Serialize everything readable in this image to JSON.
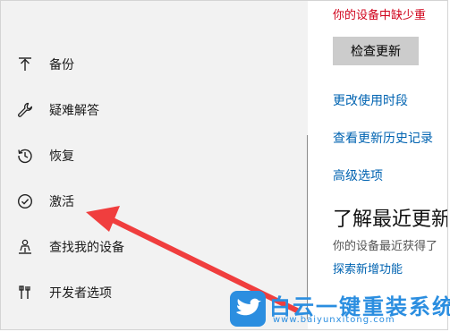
{
  "sidebar": {
    "items": [
      {
        "label": "备份",
        "icon": "backup-arrow-icon"
      },
      {
        "label": "疑难解答",
        "icon": "wrench-icon"
      },
      {
        "label": "恢复",
        "icon": "history-icon"
      },
      {
        "label": "激活",
        "icon": "checkmark-circle-icon"
      },
      {
        "label": "查找我的设备",
        "icon": "find-device-person-icon"
      },
      {
        "label": "开发者选项",
        "icon": "developer-tools-icon"
      }
    ]
  },
  "main": {
    "warning": "你的设备中缺少重",
    "check_button": "检查更新",
    "links": [
      "更改使用时段",
      "查看更新历史记录",
      "高级选项"
    ],
    "heading": "了解最近更新",
    "desc": "你的设备最近获得了",
    "explore_link": "探索新增功能"
  },
  "watermark": {
    "title": "白云一键重装系统",
    "url": "www.baiyunxitong.com"
  },
  "colors": {
    "accent_link": "#0063b1",
    "warning": "#d0021b",
    "arrow": "#f03e3e",
    "watermark": "#2b8ee0"
  }
}
